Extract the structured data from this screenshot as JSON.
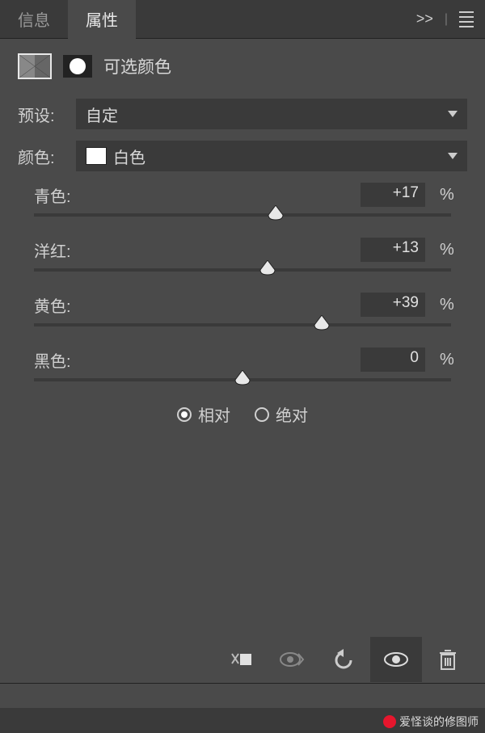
{
  "tabs": {
    "info": "信息",
    "properties": "属性"
  },
  "panel_title": "可选颜色",
  "preset": {
    "label": "预设:",
    "value": "自定"
  },
  "color": {
    "label": "颜色:",
    "value": "白色",
    "swatch": "#ffffff"
  },
  "sliders": {
    "cyan": {
      "label": "青色:",
      "value": "+17",
      "percent": 58
    },
    "magenta": {
      "label": "洋红:",
      "value": "+13",
      "percent": 56
    },
    "yellow": {
      "label": "黄色:",
      "value": "+39",
      "percent": 69
    },
    "black": {
      "label": "黑色:",
      "value": "0",
      "percent": 50
    }
  },
  "unit": "%",
  "method": {
    "relative": "相对",
    "absolute": "绝对",
    "selected": "relative"
  },
  "watermark": "爱怪谈的修图师"
}
